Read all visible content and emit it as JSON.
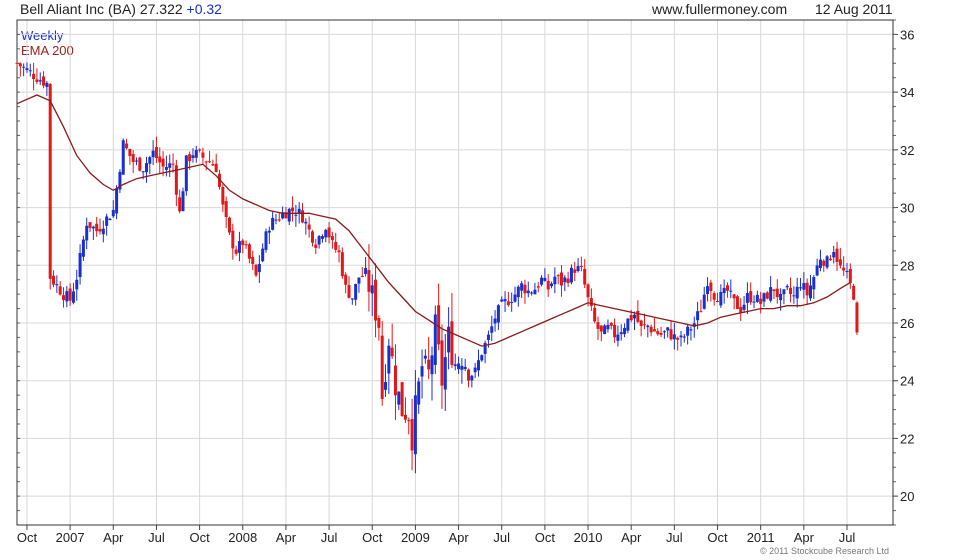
{
  "header": {
    "ticker_text": "Bell Aliant Inc (BA) 27.322",
    "change_text": "+0.32",
    "site": "www.fullermoney.com",
    "date": "12 Aug 2011"
  },
  "legend": {
    "series1": "Weekly",
    "series2": "EMA 200"
  },
  "copyright": "© 2011 Stockcube Research Ltd",
  "colors": {
    "up": "#1a2fd0",
    "down": "#e01818",
    "ema": "#8b1a1a",
    "grid": "#d8d8d8"
  },
  "chart_data": {
    "type": "line",
    "title": "Bell Aliant Inc (BA) 27.322 +0.32",
    "ylim": [
      19,
      36.5
    ],
    "yticks": [
      20,
      22,
      24,
      26,
      28,
      30,
      32,
      34,
      36
    ],
    "xlim": [
      0,
      250
    ],
    "xticks": [
      {
        "label": "Oct",
        "week": 3
      },
      {
        "label": "2007",
        "week": 16
      },
      {
        "label": "Apr",
        "week": 29
      },
      {
        "label": "Jul",
        "week": 42
      },
      {
        "label": "Oct",
        "week": 55
      },
      {
        "label": "2008",
        "week": 68
      },
      {
        "label": "Apr",
        "week": 81
      },
      {
        "label": "Jul",
        "week": 94
      },
      {
        "label": "Oct",
        "week": 107
      },
      {
        "label": "2009",
        "week": 120
      },
      {
        "label": "Apr",
        "week": 133
      },
      {
        "label": "Jul",
        "week": 146
      },
      {
        "label": "Oct",
        "week": 159
      },
      {
        "label": "2010",
        "week": 172
      },
      {
        "label": "Apr",
        "week": 185
      },
      {
        "label": "Jul",
        "week": 198
      },
      {
        "label": "Oct",
        "week": 211
      },
      {
        "label": "2011",
        "week": 224
      },
      {
        "label": "Apr",
        "week": 237
      },
      {
        "label": "Jul",
        "week": 250
      }
    ],
    "weekly_close_path": [
      [
        0,
        35.0
      ],
      [
        5,
        34.6
      ],
      [
        9,
        34.3
      ],
      [
        10,
        27.6
      ],
      [
        14,
        27.0
      ],
      [
        16,
        26.8
      ],
      [
        18,
        27.6
      ],
      [
        21,
        29.5
      ],
      [
        24,
        29.2
      ],
      [
        29,
        29.9
      ],
      [
        32,
        32.2
      ],
      [
        35,
        31.6
      ],
      [
        38,
        31.4
      ],
      [
        41,
        31.9
      ],
      [
        44,
        31.4
      ],
      [
        47,
        31.5
      ],
      [
        49,
        29.8
      ],
      [
        51,
        31.6
      ],
      [
        53,
        31.9
      ],
      [
        55,
        31.8
      ],
      [
        58,
        31.6
      ],
      [
        60,
        31.4
      ],
      [
        62,
        30.0
      ],
      [
        64,
        29.0
      ],
      [
        66,
        28.5
      ],
      [
        68,
        28.8
      ],
      [
        70,
        28.2
      ],
      [
        72,
        27.6
      ],
      [
        74,
        28.6
      ],
      [
        76,
        29.4
      ],
      [
        78,
        29.6
      ],
      [
        80,
        29.8
      ],
      [
        82,
        29.9
      ],
      [
        84,
        29.9
      ],
      [
        86,
        29.7
      ],
      [
        88,
        29.2
      ],
      [
        90,
        28.8
      ],
      [
        93,
        29.4
      ],
      [
        95,
        28.7
      ],
      [
        97,
        28.4
      ],
      [
        99,
        27.2
      ],
      [
        101,
        26.9
      ],
      [
        103,
        27.6
      ],
      [
        105,
        27.7
      ],
      [
        107,
        26.9
      ],
      [
        109,
        26.0
      ],
      [
        110,
        23.5
      ],
      [
        112,
        25.5
      ],
      [
        114,
        23.9
      ],
      [
        116,
        23.0
      ],
      [
        118,
        22.9
      ],
      [
        119,
        22.1
      ],
      [
        120,
        23.0
      ],
      [
        122,
        24.5
      ],
      [
        124,
        24.2
      ],
      [
        126,
        25.8
      ],
      [
        128,
        24.0
      ],
      [
        130,
        25.5
      ],
      [
        132,
        24.6
      ],
      [
        134,
        24.9
      ],
      [
        136,
        24.2
      ],
      [
        138,
        24.3
      ],
      [
        140,
        25.0
      ],
      [
        142,
        25.5
      ],
      [
        144,
        26.2
      ],
      [
        146,
        26.6
      ],
      [
        148,
        26.8
      ],
      [
        150,
        27.0
      ],
      [
        152,
        27.3
      ],
      [
        154,
        27.1
      ],
      [
        156,
        27.2
      ],
      [
        158,
        27.5
      ],
      [
        160,
        27.2
      ],
      [
        162,
        27.6
      ],
      [
        164,
        27.4
      ],
      [
        166,
        27.6
      ],
      [
        168,
        27.9
      ],
      [
        170,
        27.8
      ],
      [
        172,
        26.8
      ],
      [
        174,
        26.0
      ],
      [
        176,
        25.6
      ],
      [
        178,
        25.8
      ],
      [
        180,
        25.6
      ],
      [
        182,
        25.8
      ],
      [
        184,
        26.1
      ],
      [
        186,
        26.3
      ],
      [
        188,
        25.8
      ],
      [
        190,
        25.9
      ],
      [
        192,
        25.7
      ],
      [
        194,
        25.6
      ],
      [
        196,
        25.7
      ],
      [
        198,
        25.5
      ],
      [
        200,
        25.4
      ],
      [
        202,
        25.7
      ],
      [
        204,
        26.0
      ],
      [
        206,
        26.5
      ],
      [
        208,
        27.5
      ],
      [
        210,
        27.0
      ],
      [
        212,
        26.9
      ],
      [
        214,
        27.1
      ],
      [
        216,
        26.7
      ],
      [
        218,
        26.5
      ],
      [
        220,
        26.9
      ],
      [
        222,
        26.9
      ],
      [
        224,
        26.7
      ],
      [
        226,
        27.0
      ],
      [
        228,
        27.2
      ],
      [
        230,
        26.8
      ],
      [
        232,
        27.1
      ],
      [
        234,
        26.9
      ],
      [
        236,
        27.4
      ],
      [
        238,
        27.0
      ],
      [
        240,
        27.6
      ],
      [
        242,
        28.3
      ],
      [
        244,
        28.1
      ],
      [
        246,
        28.6
      ],
      [
        248,
        27.9
      ],
      [
        250,
        27.6
      ],
      [
        252,
        27.0
      ],
      [
        253,
        25.5
      ]
    ],
    "ema200": [
      [
        0,
        33.6
      ],
      [
        6,
        33.9
      ],
      [
        10,
        33.7
      ],
      [
        14,
        32.8
      ],
      [
        18,
        31.8
      ],
      [
        22,
        31.2
      ],
      [
        26,
        30.8
      ],
      [
        29,
        30.6
      ],
      [
        32,
        30.8
      ],
      [
        36,
        31.0
      ],
      [
        40,
        31.1
      ],
      [
        44,
        31.2
      ],
      [
        48,
        31.3
      ],
      [
        52,
        31.4
      ],
      [
        56,
        31.5
      ],
      [
        60,
        31.1
      ],
      [
        64,
        30.6
      ],
      [
        68,
        30.3
      ],
      [
        72,
        30.1
      ],
      [
        76,
        29.9
      ],
      [
        80,
        29.8
      ],
      [
        84,
        29.8
      ],
      [
        88,
        29.8
      ],
      [
        92,
        29.7
      ],
      [
        96,
        29.6
      ],
      [
        100,
        29.2
      ],
      [
        104,
        28.6
      ],
      [
        108,
        28.0
      ],
      [
        112,
        27.4
      ],
      [
        116,
        26.9
      ],
      [
        120,
        26.4
      ],
      [
        124,
        26.1
      ],
      [
        128,
        25.8
      ],
      [
        132,
        25.6
      ],
      [
        136,
        25.4
      ],
      [
        140,
        25.2
      ],
      [
        144,
        25.3
      ],
      [
        148,
        25.5
      ],
      [
        152,
        25.7
      ],
      [
        156,
        25.9
      ],
      [
        160,
        26.1
      ],
      [
        164,
        26.3
      ],
      [
        168,
        26.5
      ],
      [
        172,
        26.7
      ],
      [
        176,
        26.6
      ],
      [
        180,
        26.5
      ],
      [
        184,
        26.4
      ],
      [
        188,
        26.3
      ],
      [
        192,
        26.2
      ],
      [
        196,
        26.1
      ],
      [
        200,
        26.0
      ],
      [
        204,
        25.9
      ],
      [
        208,
        26.0
      ],
      [
        212,
        26.2
      ],
      [
        216,
        26.3
      ],
      [
        220,
        26.4
      ],
      [
        224,
        26.5
      ],
      [
        228,
        26.5
      ],
      [
        232,
        26.6
      ],
      [
        236,
        26.6
      ],
      [
        240,
        26.7
      ],
      [
        244,
        26.9
      ],
      [
        248,
        27.2
      ],
      [
        251,
        27.4
      ]
    ]
  }
}
